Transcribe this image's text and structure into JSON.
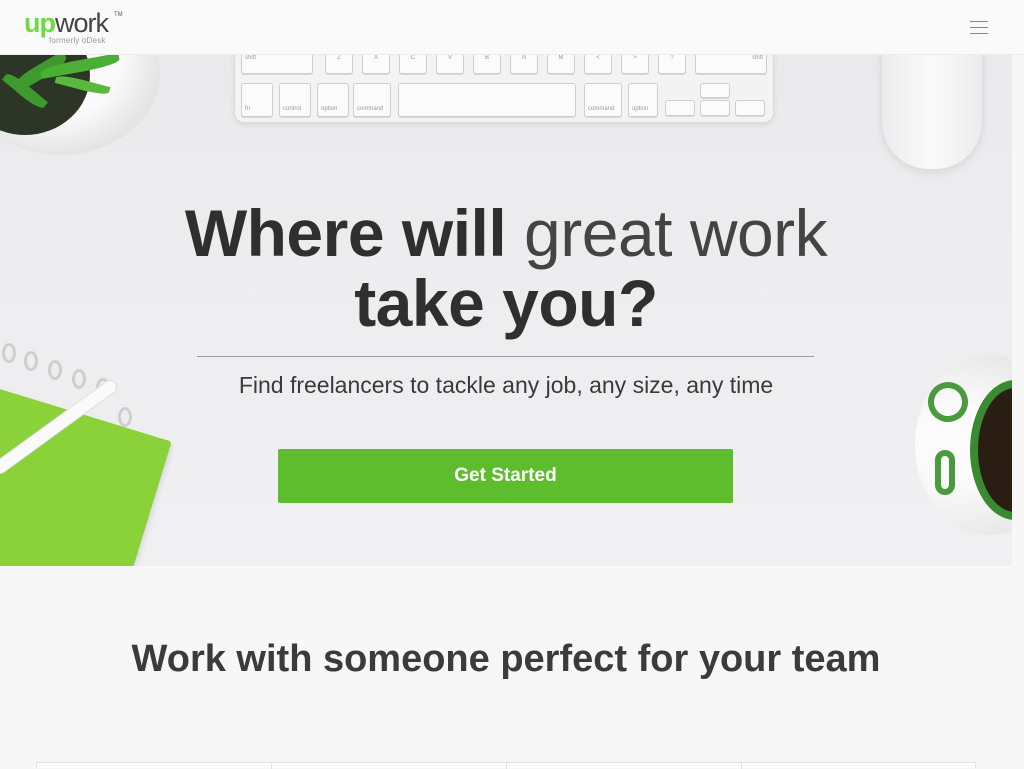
{
  "header": {
    "logo_up": "Up",
    "logo_work": "work",
    "logo_tm": "TM",
    "logo_subtitle": "formerly oDesk",
    "menu_icon": "hamburger-menu-icon"
  },
  "hero": {
    "title_bold_1": "Where will",
    "title_light": "great work",
    "title_bold_2": "take you?",
    "subtitle": "Find freelancers to tackle any job, any size, any time",
    "cta_label": "Get Started"
  },
  "keyboard": {
    "row1": [
      "shift",
      "Z",
      "X",
      "C",
      "V",
      "B",
      "N",
      "M",
      "<",
      ">",
      "?",
      "shift"
    ],
    "row2": [
      "fn",
      "control",
      "option",
      "command",
      "",
      "command",
      "option"
    ]
  },
  "section": {
    "title": "Work with someone perfect for your team"
  },
  "colors": {
    "accent": "#5dbd2c",
    "logo_green": "#6fda44",
    "text_dark": "#333333"
  }
}
